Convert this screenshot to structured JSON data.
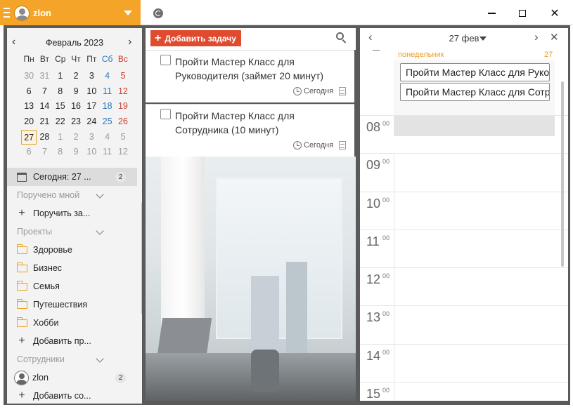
{
  "titlebar": {
    "user_name": "zlon",
    "icons": [
      "hamburger-icon",
      "user-avatar-icon",
      "caret-down-icon",
      "sync-icon",
      "minimize-icon",
      "maximize-icon",
      "close-icon"
    ],
    "close_glyph": "✕"
  },
  "calendar": {
    "title": "Февраль 2023",
    "prev": "‹",
    "next": "›",
    "weekdays": [
      "Пн",
      "Вт",
      "Ср",
      "Чт",
      "Пт",
      "Сб",
      "Вс"
    ],
    "weeks": [
      [
        {
          "d": "30",
          "m": true
        },
        {
          "d": "31",
          "m": true
        },
        {
          "d": "1"
        },
        {
          "d": "2"
        },
        {
          "d": "3"
        },
        {
          "d": "4",
          "w": "sat"
        },
        {
          "d": "5",
          "w": "sun"
        }
      ],
      [
        {
          "d": "6"
        },
        {
          "d": "7"
        },
        {
          "d": "8"
        },
        {
          "d": "9"
        },
        {
          "d": "10"
        },
        {
          "d": "11",
          "w": "sat"
        },
        {
          "d": "12",
          "w": "sun"
        }
      ],
      [
        {
          "d": "13"
        },
        {
          "d": "14"
        },
        {
          "d": "15"
        },
        {
          "d": "16"
        },
        {
          "d": "17"
        },
        {
          "d": "18",
          "w": "sat"
        },
        {
          "d": "19",
          "w": "sun"
        }
      ],
      [
        {
          "d": "20"
        },
        {
          "d": "21"
        },
        {
          "d": "22"
        },
        {
          "d": "23"
        },
        {
          "d": "24"
        },
        {
          "d": "25",
          "w": "sat"
        },
        {
          "d": "26",
          "w": "sun"
        }
      ],
      [
        {
          "d": "27",
          "today": true
        },
        {
          "d": "28"
        },
        {
          "d": "1",
          "m": true
        },
        {
          "d": "2",
          "m": true
        },
        {
          "d": "3",
          "m": true
        },
        {
          "d": "4",
          "m": true,
          "w": "sat"
        },
        {
          "d": "5",
          "m": true,
          "w": "sun"
        }
      ],
      [
        {
          "d": "6",
          "m": true
        },
        {
          "d": "7",
          "m": true
        },
        {
          "d": "8",
          "m": true
        },
        {
          "d": "9",
          "m": true
        },
        {
          "d": "10",
          "m": true
        },
        {
          "d": "11",
          "m": true,
          "w": "sat"
        },
        {
          "d": "12",
          "m": true,
          "w": "sun"
        }
      ]
    ]
  },
  "sidebar": {
    "today_label": "Сегодня: 27 ...",
    "today_count": "2",
    "assigned_section": "Поручено мной",
    "assign_task": "Поручить за...",
    "projects_section": "Проекты",
    "projects": [
      "Здоровье",
      "Бизнес",
      "Семья",
      "Путешествия",
      "Хобби"
    ],
    "add_project": "Добавить пр...",
    "staff_section": "Сотрудники",
    "staff_name": "zlon",
    "staff_count": "2",
    "add_staff": "Добавить со..."
  },
  "tasks": {
    "add_button": "Добавить задачу",
    "add_glyph": "+",
    "items": [
      {
        "title": "Пройти Мастер Класс для Руководителя (займет 20 минут)",
        "date": "Сегодня"
      },
      {
        "title": "Пройти Мастер Класс для Сотрудника (10 минут)",
        "date": "Сегодня"
      }
    ]
  },
  "day_view": {
    "title": "27 фев",
    "prev": "‹",
    "next": "›",
    "close": "✕",
    "weekday": "понедельник",
    "day_number": "27",
    "events": [
      "Пройти Мастер Класс для Руководителя",
      "Пройти Мастер Класс для Сотрудника"
    ],
    "hours": [
      "08",
      "09",
      "10",
      "11",
      "12",
      "13",
      "14",
      "15"
    ],
    "minutes": "00"
  },
  "colors": {
    "accent": "#f5a42a",
    "add_button": "#e04a2f",
    "saturday": "#2b77c0",
    "sunday": "#d23a2a",
    "today_border": "#e0a436",
    "weekday_label": "#e89f2a"
  }
}
